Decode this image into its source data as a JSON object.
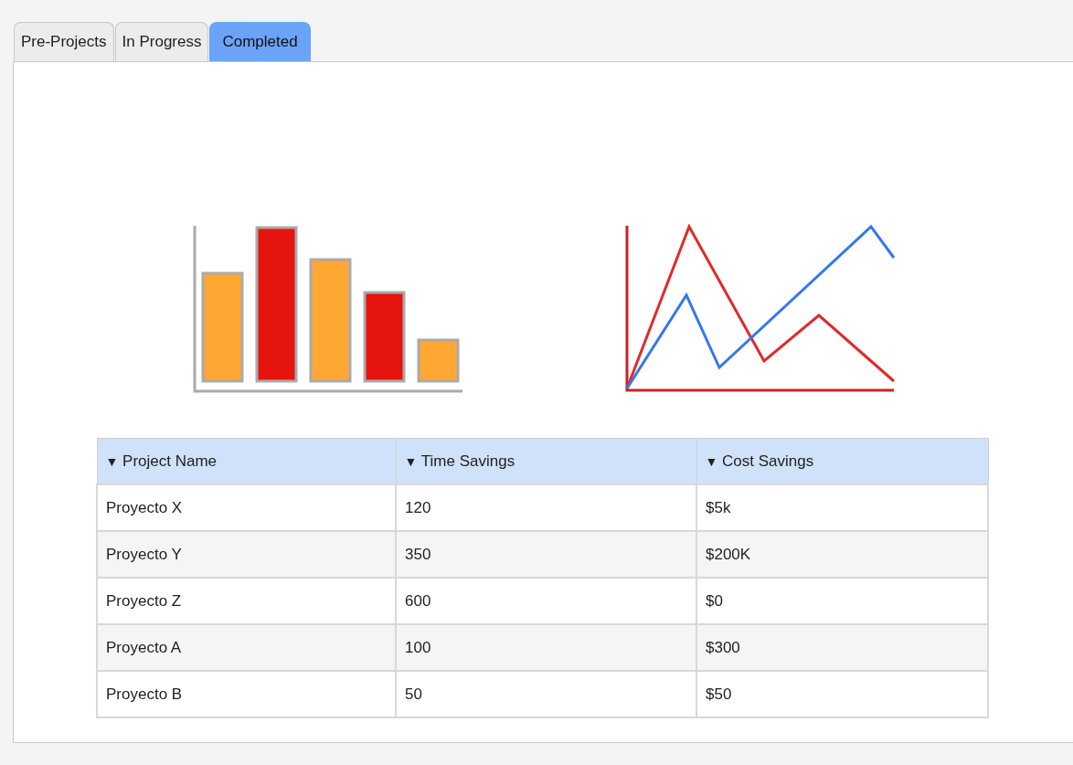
{
  "tabs": [
    {
      "label": "Pre-Projects",
      "selected": false
    },
    {
      "label": "In Progress",
      "selected": false
    },
    {
      "label": "Completed",
      "selected": true
    }
  ],
  "table": {
    "columns": [
      {
        "arrow": "▼",
        "label": "Project Name"
      },
      {
        "arrow": "▼",
        "label": "Time Savings"
      },
      {
        "arrow": "▼",
        "label": "Cost Savings"
      }
    ],
    "rows": [
      [
        "Proyecto X",
        "120",
        "$5k"
      ],
      [
        "Proyecto Y",
        "350",
        "$200K"
      ],
      [
        "Proyecto Z",
        "600",
        "$0"
      ],
      [
        "Proyecto A",
        "100",
        "$300"
      ],
      [
        "Proyecto B",
        "50",
        "$50"
      ]
    ]
  }
}
